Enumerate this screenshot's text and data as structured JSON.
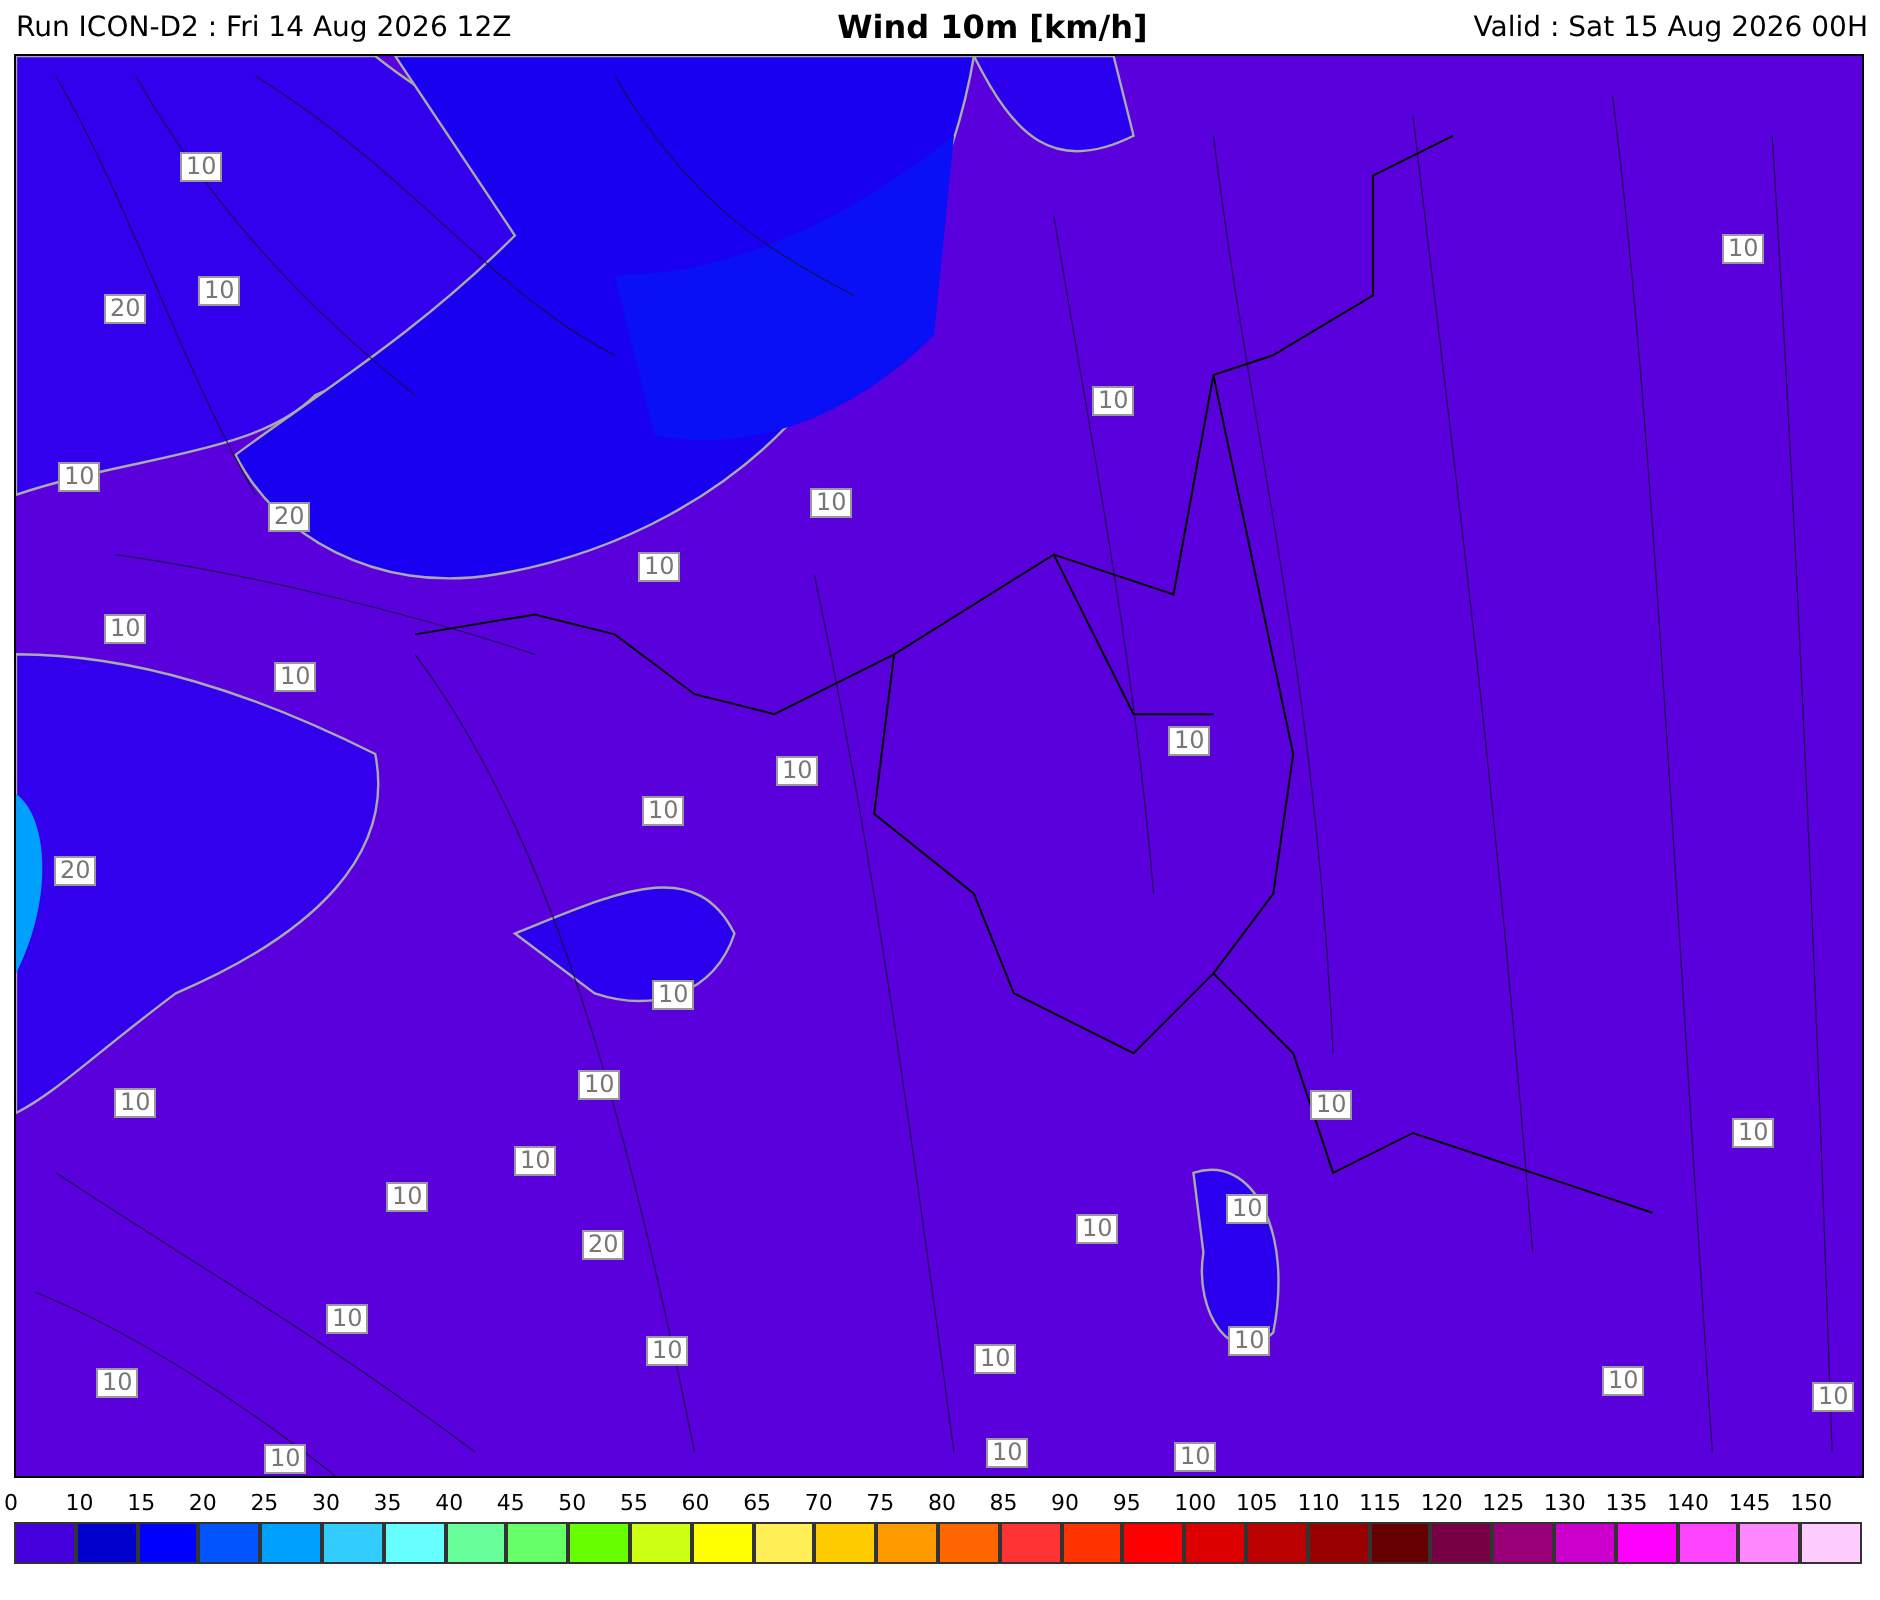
{
  "header": {
    "run": "Run ICON-D2 : Fri 14 Aug 2026 12Z",
    "title": "Wind 10m [km/h]",
    "valid": "Valid : Sat 15 Aug 2026 00H"
  },
  "map": {
    "contour_labels": [
      "10",
      "10",
      "20",
      "10",
      "20",
      "10",
      "10",
      "10",
      "10",
      "10",
      "10",
      "10",
      "10",
      "10",
      "20",
      "10",
      "10",
      "10",
      "10",
      "10",
      "10",
      "10",
      "10",
      "10",
      "20",
      "10",
      "10",
      "10",
      "10",
      "10",
      "10",
      "10",
      "10",
      "10",
      "10"
    ]
  },
  "legend": {
    "ticks": [
      "0",
      "10",
      "15",
      "20",
      "25",
      "30",
      "35",
      "40",
      "45",
      "50",
      "55",
      "60",
      "65",
      "70",
      "75",
      "80",
      "85",
      "90",
      "95",
      "100",
      "105",
      "110",
      "115",
      "120",
      "125",
      "130",
      "135",
      "140",
      "145",
      "150"
    ],
    "bins": [
      {
        "color": "#4400dd"
      },
      {
        "color": "#0000cc"
      },
      {
        "color": "#0000ff"
      },
      {
        "color": "#0055ff"
      },
      {
        "color": "#00a0ff"
      },
      {
        "color": "#33ccff"
      },
      {
        "color": "#66ffff"
      },
      {
        "color": "#66ff99"
      },
      {
        "color": "#66ff66"
      },
      {
        "color": "#66ff00"
      },
      {
        "color": "#ccff11"
      },
      {
        "color": "#ffff00"
      },
      {
        "color": "#ffee55"
      },
      {
        "color": "#ffcc00"
      },
      {
        "color": "#ff9900"
      },
      {
        "color": "#ff6600"
      },
      {
        "color": "#ff3333"
      },
      {
        "color": "#ff3300"
      },
      {
        "color": "#ff0000"
      },
      {
        "color": "#dd0000"
      },
      {
        "color": "#bb0000"
      },
      {
        "color": "#990000"
      },
      {
        "color": "#660000"
      },
      {
        "color": "#770044"
      },
      {
        "color": "#990077"
      },
      {
        "color": "#cc00cc"
      },
      {
        "color": "#ff00ff"
      },
      {
        "color": "#ff44ff"
      },
      {
        "color": "#ff88ff"
      },
      {
        "color": "#ffccff"
      }
    ]
  }
}
